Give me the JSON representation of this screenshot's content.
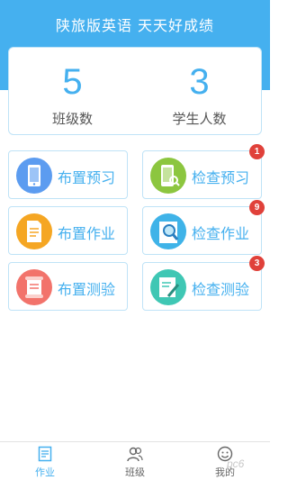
{
  "header": {
    "title": "陕旅版英语 天天好成绩",
    "bg_color": "#45b0ef"
  },
  "stats": [
    {
      "value": "5",
      "label": "班级数"
    },
    {
      "value": "3",
      "label": "学生人数"
    }
  ],
  "tiles": [
    {
      "label": "布置预习",
      "icon": "phone-preview-icon",
      "color": "#5c9cf0",
      "badge": ""
    },
    {
      "label": "检查预习",
      "icon": "phone-check-icon",
      "color": "#8cc63f",
      "badge": "1"
    },
    {
      "label": "布置作业",
      "icon": "document-edit-icon",
      "color": "#f5a623",
      "badge": ""
    },
    {
      "label": "检查作业",
      "icon": "magnifier-icon",
      "color": "#3fb3e8",
      "badge": "9"
    },
    {
      "label": "布置测验",
      "icon": "scroll-icon",
      "color": "#f2736b",
      "badge": ""
    },
    {
      "label": "检查测验",
      "icon": "paper-pen-icon",
      "color": "#3fc7b4",
      "badge": "3"
    }
  ],
  "tabbar": {
    "items": [
      {
        "label": "作业",
        "icon": "homework-list-icon",
        "active": true
      },
      {
        "label": "班级",
        "icon": "class-people-icon",
        "active": false
      },
      {
        "label": "我的",
        "icon": "smiley-profile-icon",
        "active": false
      }
    ]
  },
  "watermark": "pc6"
}
